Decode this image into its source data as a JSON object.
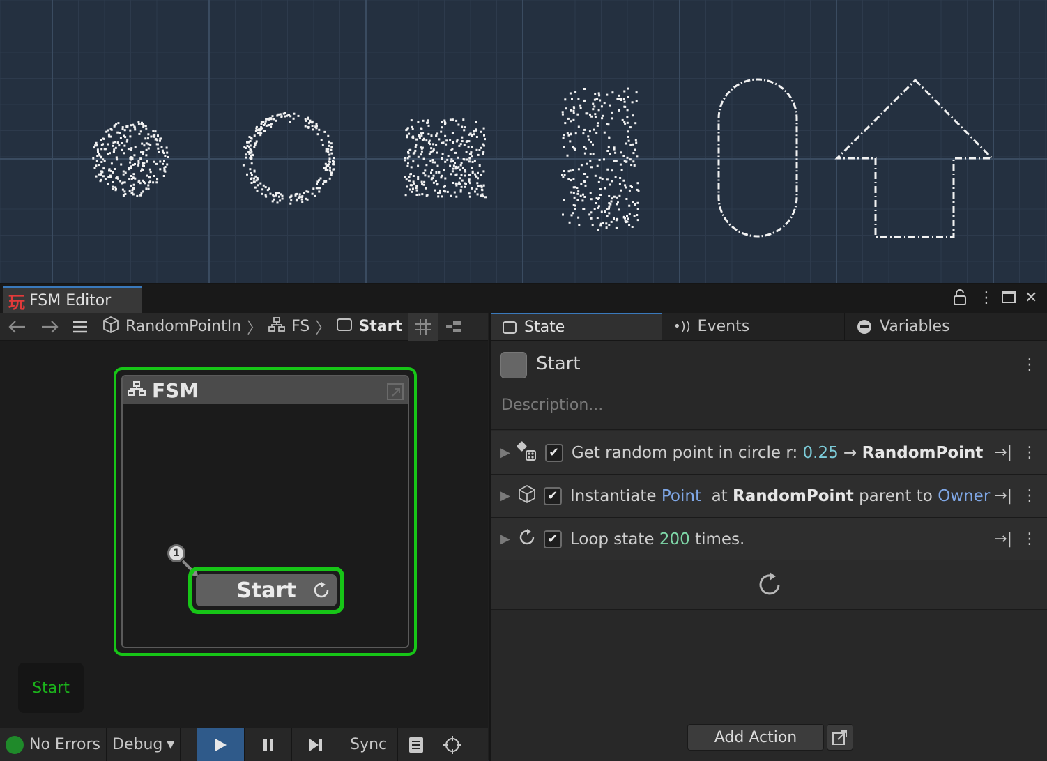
{
  "window": {
    "logo": "玩",
    "title": "FSM Editor"
  },
  "breadcrumb": {
    "items": [
      "RandomPointIn",
      "FS",
      "Start"
    ]
  },
  "graph": {
    "fsm_title": "FSM",
    "state_label": "Start",
    "start_marker": "1",
    "minimap_label": "Start"
  },
  "status": {
    "errors": "No Errors",
    "debug": "Debug",
    "sync": "Sync"
  },
  "inspector": {
    "tabs": [
      "State",
      "Events",
      "Variables"
    ],
    "state_name": "Start",
    "description_placeholder": "Description...",
    "actions": [
      {
        "prefix": "Get random point in circle r: ",
        "value": "0.25",
        "arrow": " → ",
        "target": "RandomPoint"
      },
      {
        "prefix": "Instantiate ",
        "object": "Point",
        "mid": "  at ",
        "point": "RandomPoint",
        "mid2": " parent to ",
        "owner": "Owner"
      },
      {
        "prefix": "Loop state ",
        "count": "200",
        "suffix": " times."
      }
    ],
    "add_action_label": "Add Action"
  },
  "colors": {
    "accent_green": "#17c517",
    "tab_accent": "#3a79bb",
    "play_active": "#2f5a8a"
  }
}
